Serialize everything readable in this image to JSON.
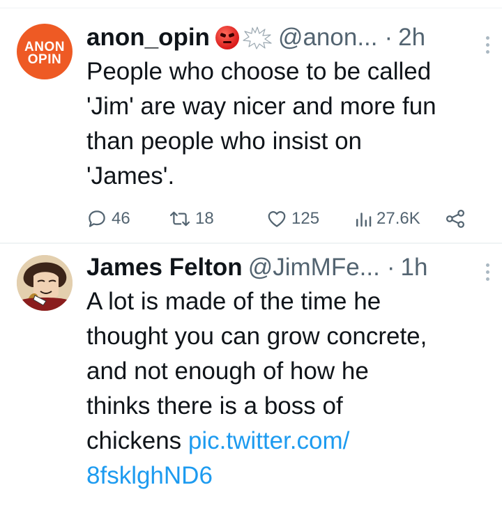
{
  "tweets": [
    {
      "avatar_text": [
        "ANON",
        "OPIN"
      ],
      "display_name": "anon_opin",
      "handle": "@anon...",
      "dot": "·",
      "time": "2h",
      "text": "People who choose to be called\n'Jim' are way nicer and more fun\nthan people who insist on\n'James'.",
      "actions": {
        "replies": "46",
        "retweets": "18",
        "likes": "125",
        "views": "27.6K"
      },
      "icons": [
        "angry-face-emoji",
        "anger-burst-emoji",
        "more-icon",
        "reply-icon",
        "retweet-icon",
        "like-icon",
        "views-icon",
        "share-icon"
      ]
    },
    {
      "display_name": "James Felton",
      "handle": "@JimMFe...",
      "dot": "·",
      "time": "1h",
      "text_plain": "A lot is made of the time he\nthought you can grow concrete,\nand not enough of how he\nthinks there is a boss of\nchickens ",
      "link": "pic.twitter.com/\n8fsklghND6",
      "icons": [
        "more-icon"
      ]
    }
  ],
  "colors": {
    "text": "#0f1419",
    "secondary": "#536471",
    "link": "#1d9bf0",
    "anon_brand": "#ee5a24"
  }
}
